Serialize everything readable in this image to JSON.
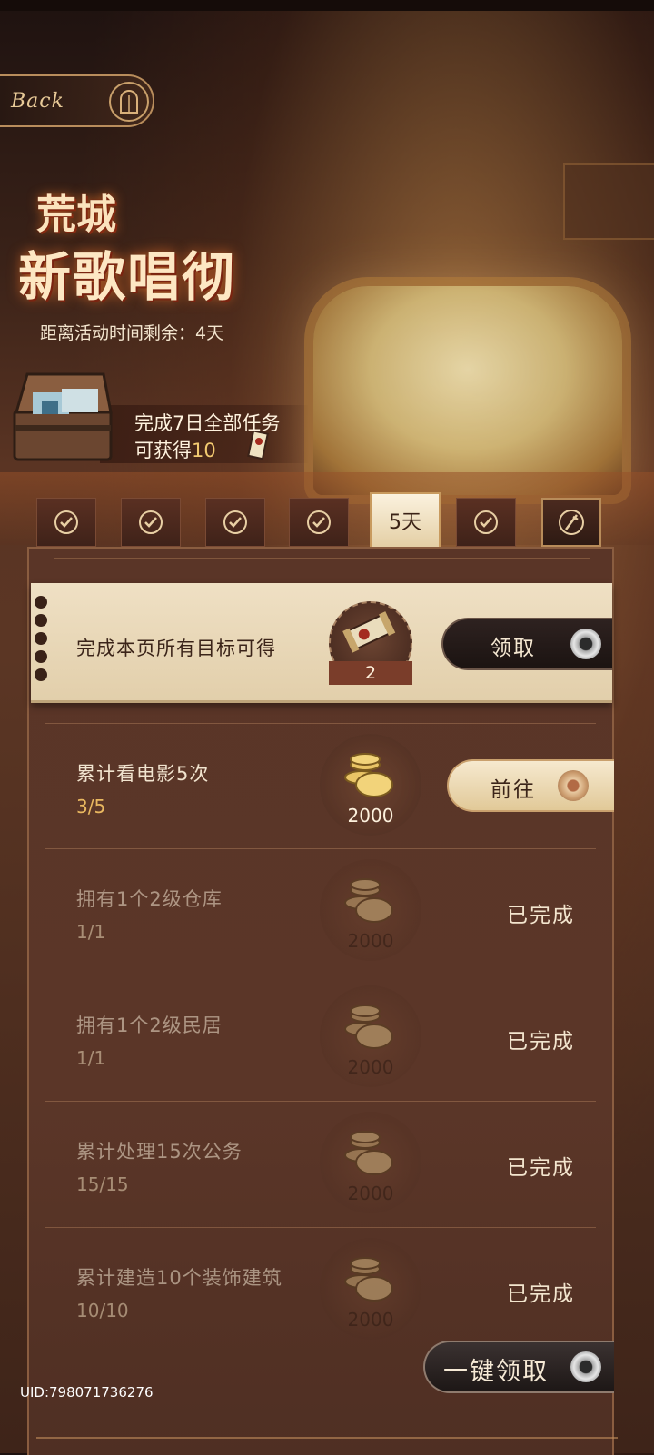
{
  "back": {
    "label": "Back"
  },
  "event": {
    "title_line1": "荒城",
    "title_line2": "新歌唱彻",
    "countdown": "距离活动时间剩余：4天"
  },
  "bonus": {
    "line1": "完成7日全部任务",
    "line2_prefix": "可获得",
    "line2_count": "10"
  },
  "tabs": [
    {
      "state": "completed",
      "icon": "check-icon"
    },
    {
      "state": "completed",
      "icon": "check-icon"
    },
    {
      "state": "completed",
      "icon": "check-icon"
    },
    {
      "state": "completed",
      "icon": "check-icon"
    },
    {
      "state": "active",
      "label": "5天"
    },
    {
      "state": "completed",
      "icon": "check-icon"
    },
    {
      "state": "final",
      "icon": "quill-icon"
    }
  ],
  "page_goal": {
    "label": "完成本页所有目标可得",
    "reward_qty": "2",
    "claim_label": "领取"
  },
  "tasks": [
    {
      "title": "累计看电影5次",
      "progress": "3/5",
      "reward": "2000",
      "action": "前往",
      "status": "in_progress"
    },
    {
      "title": "拥有1个2级仓库",
      "progress": "1/1",
      "reward": "2000",
      "action": "已完成",
      "status": "done"
    },
    {
      "title": "拥有1个2级民居",
      "progress": "1/1",
      "reward": "2000",
      "action": "已完成",
      "status": "done"
    },
    {
      "title": "累计处理15次公务",
      "progress": "15/15",
      "reward": "2000",
      "action": "已完成",
      "status": "done"
    },
    {
      "title": "累计建造10个装饰建筑",
      "progress": "10/10",
      "reward": "2000",
      "action": "已完成",
      "status": "done"
    }
  ],
  "bulk_claim": {
    "label": "一键领取"
  },
  "uid": "UID:798071736276",
  "colors": {
    "accent_gold": "#e9b860",
    "panel": "#5a3527",
    "paper": "#efe0c4"
  }
}
